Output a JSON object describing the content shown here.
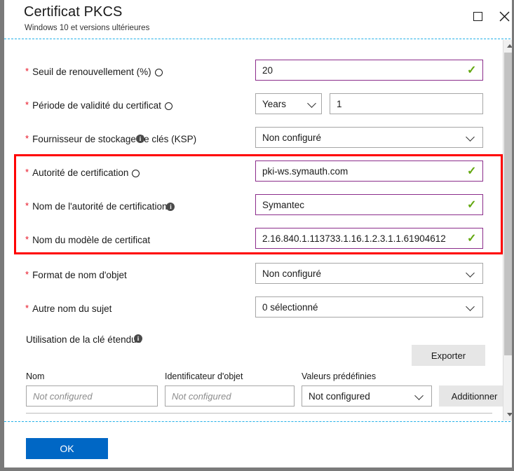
{
  "window": {
    "title": "Certificat PKCS",
    "subtitle": "Windows 10 et versions ultérieures",
    "maximize_label": "Maximize",
    "close_label": "✕"
  },
  "form": {
    "required_marker": "*",
    "rows": [
      {
        "label": "Seuil de renouvellement (%)",
        "info": "outline",
        "control": "input",
        "value": "20",
        "valid": "✓"
      },
      {
        "label": "Période de validité du certificat",
        "info": "outline",
        "control": "select-plus-input",
        "select_value": "Years",
        "value": "1"
      },
      {
        "label": "Fournisseur de stockage de clés (KSP)",
        "info": "overlap",
        "control": "select",
        "value": "Non configuré"
      },
      {
        "label": "Autorité de certification",
        "info": "outline",
        "control": "input",
        "value": "pki-ws.symauth.com",
        "valid": "✓"
      },
      {
        "label": "Nom de l'autorité de certification",
        "info": "filled",
        "control": "input",
        "value": "Symantec",
        "valid": "✓"
      },
      {
        "label": "Nom du modèle de certificat",
        "info": "none",
        "control": "input",
        "value": "2.16.840.1.113733.1.16.1.2.3.1.1.61904612",
        "valid": "✓"
      },
      {
        "label": "Format de nom d'objet",
        "info": "none",
        "control": "select",
        "value": "Non configuré"
      },
      {
        "label": "Autre nom du sujet",
        "info": "none",
        "control": "select",
        "value": "0 sélectionné"
      }
    ]
  },
  "eku": {
    "section_label": "Utilisation de la clé étendue",
    "info_char": "i",
    "export_button": "Exporter",
    "columns": [
      "Nom",
      "Identificateur d'objet",
      "Valeurs prédéfinies"
    ],
    "name_placeholder": "Not configured",
    "oid_placeholder": "Not configured",
    "predefined_value": "Not configured",
    "add_button": "Additionner"
  },
  "footer": {
    "ok_label": "OK"
  },
  "colors": {
    "accent_blue": "#0067c5",
    "valid_purple": "#8b2d8b",
    "valid_green": "#62a70f",
    "required_red": "#e81123",
    "highlight_red": "#ff0000",
    "dashed_cyan": "#23b0e8"
  }
}
